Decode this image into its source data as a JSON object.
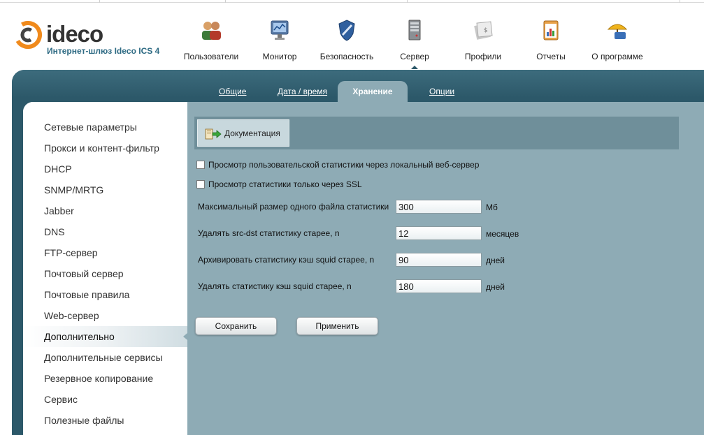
{
  "brand": {
    "name": "ideco",
    "subtitle": "Интернет-шлюз Ideco ICS 4"
  },
  "nav": {
    "items": [
      {
        "label": "Пользователи",
        "icon": "users-icon"
      },
      {
        "label": "Монитор",
        "icon": "monitor-icon"
      },
      {
        "label": "Безопасность",
        "icon": "shield-icon"
      },
      {
        "label": "Сервер",
        "icon": "server-icon",
        "active": true
      },
      {
        "label": "Профили",
        "icon": "profiles-icon"
      },
      {
        "label": "Отчеты",
        "icon": "reports-icon"
      },
      {
        "label": "О программе",
        "icon": "about-icon"
      }
    ]
  },
  "subtabs": {
    "items": [
      {
        "label": "Общие"
      },
      {
        "label": "Дата / время"
      },
      {
        "label": "Хранение",
        "active": true
      },
      {
        "label": "Опции"
      }
    ]
  },
  "sidebar": {
    "items": [
      {
        "label": "Сетевые параметры"
      },
      {
        "label": "Прокси и контент-фильтр"
      },
      {
        "label": "DHCP"
      },
      {
        "label": "SNMP/MRTG"
      },
      {
        "label": "Jabber"
      },
      {
        "label": "DNS"
      },
      {
        "label": "FTP-сервер"
      },
      {
        "label": "Почтовый сервер"
      },
      {
        "label": "Почтовые правила"
      },
      {
        "label": "Web-сервер"
      },
      {
        "label": "Дополнительно",
        "active": true
      },
      {
        "label": "Дополнительные сервисы"
      },
      {
        "label": "Резервное копирование"
      },
      {
        "label": "Сервис"
      },
      {
        "label": "Полезные файлы"
      }
    ]
  },
  "toolbar": {
    "doc_label": "Документация"
  },
  "form": {
    "checkboxes": [
      {
        "label": "Просмотр пользовательской статистики через локальный веб-сервер",
        "checked": false
      },
      {
        "label": "Просмотр статистики только через SSL",
        "checked": false
      }
    ],
    "fields": [
      {
        "label": "Максимальный размер одного файла статистики",
        "value": "300",
        "unit": "Мб"
      },
      {
        "label": "Удалять src-dst статистику старее, n",
        "value": "12",
        "unit": "месяцев"
      },
      {
        "label": "Архивировать статистику кэш squid старее, n",
        "value": "90",
        "unit": "дней"
      },
      {
        "label": "Удалять статистику кэш squid старее, n",
        "value": "180",
        "unit": "дней"
      }
    ],
    "save_label": "Сохранить",
    "apply_label": "Применить"
  },
  "colors": {
    "panel_dark": "#2c5869",
    "panel_light": "#8eabb5",
    "toolbar": "#6f8f9a",
    "brand_blue": "#2d6a83",
    "logo_orange": "#f08a1c"
  }
}
